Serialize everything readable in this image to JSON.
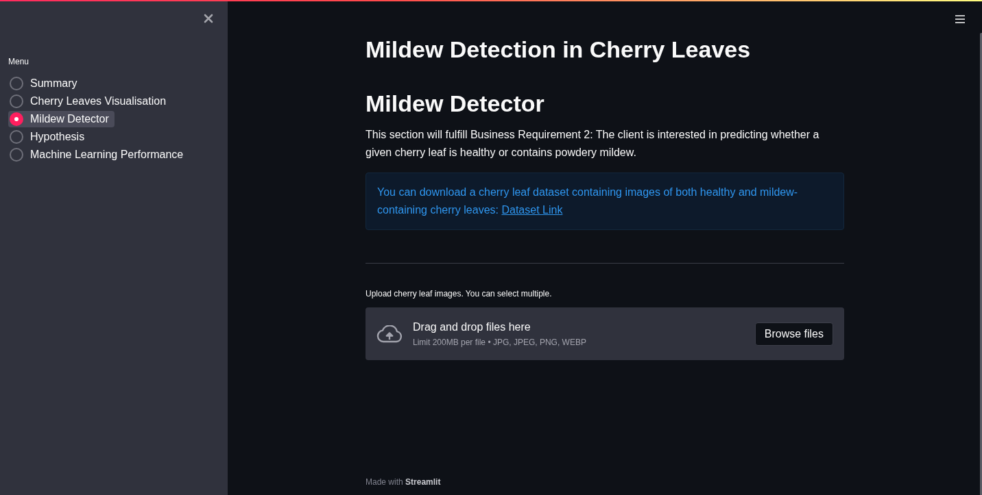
{
  "sidebar": {
    "menu": {
      "label": "Menu",
      "items": [
        {
          "label": "Summary",
          "selected": false
        },
        {
          "label": "Cherry Leaves Visualisation",
          "selected": false
        },
        {
          "label": "Mildew Detector",
          "selected": true
        },
        {
          "label": "Hypothesis",
          "selected": false
        },
        {
          "label": "Machine Learning Performance",
          "selected": false
        }
      ]
    }
  },
  "main": {
    "title": "Mildew Detection in Cherry Leaves",
    "header": "Mildew Detector",
    "description": "This section will fulfill Business Requirement 2: The client is interested in predicting whether a given cherry leaf is healthy or contains powdery mildew.",
    "info": {
      "text": "You can download a cherry leaf dataset containing images of both healthy and mildew-containing cherry leaves:",
      "link": "Dataset Link"
    },
    "uploader": {
      "label": "Upload cherry leaf images. You can select multiple.",
      "drop_title": "Drag and drop files here",
      "limits": "Limit 200MB per file • JPG, JPEG, PNG, WEBP",
      "button": "Browse files"
    },
    "footer": "Made with **Streamlit**"
  }
}
